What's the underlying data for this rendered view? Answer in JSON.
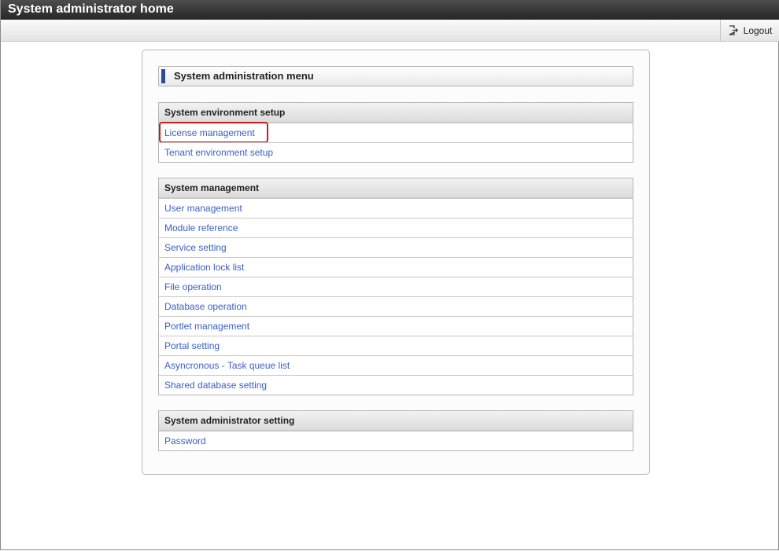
{
  "window": {
    "title": "System administrator home"
  },
  "toolbar": {
    "logout_label": "Logout"
  },
  "menu": {
    "title": "System administration menu"
  },
  "sections": [
    {
      "header": "System environment setup",
      "items": [
        "License management",
        "Tenant environment setup"
      ]
    },
    {
      "header": "System management",
      "items": [
        "User management",
        "Module reference",
        "Service setting",
        "Application lock list",
        "File operation",
        "Database operation",
        "Portlet management",
        "Portal setting",
        "Asyncronous - Task queue list",
        "Shared database setting"
      ]
    },
    {
      "header": "System administrator setting",
      "items": [
        "Password"
      ]
    }
  ],
  "icons": {
    "logout": "logout-icon"
  },
  "colors": {
    "link": "#3a5fc6",
    "accent_bar": "#2d4c8e",
    "highlight": "#cc1b1b"
  }
}
